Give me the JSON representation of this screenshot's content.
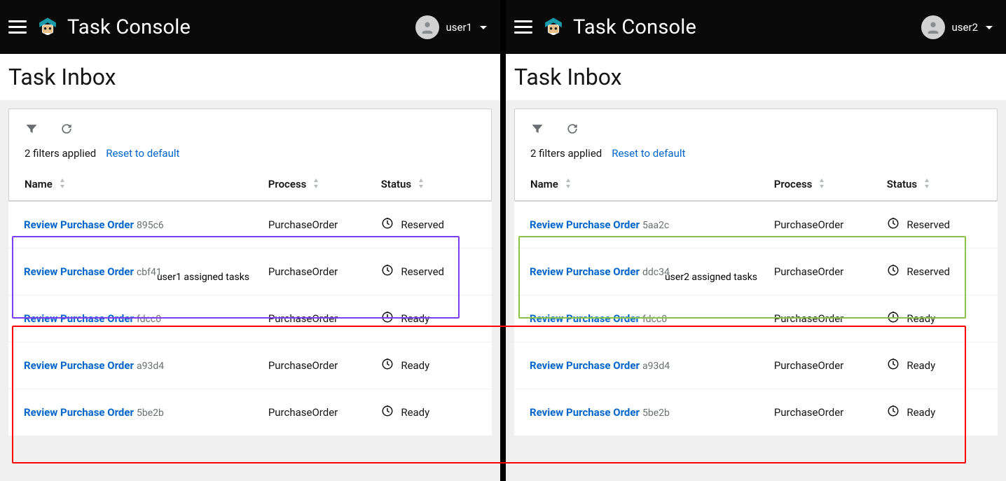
{
  "app_title": "Task Console",
  "page_title": "Task Inbox",
  "filters": {
    "count_text": "2 filters applied",
    "reset_text": "Reset to default"
  },
  "columns": {
    "name": "Name",
    "process": "Process",
    "status": "Status"
  },
  "panels": [
    {
      "user": "user1",
      "annotation_label": "user1 assigned tasks",
      "tasks": [
        {
          "name": "Review Purchase Order",
          "id": "895c6",
          "process": "PurchaseOrder",
          "status": "Reserved"
        },
        {
          "name": "Review Purchase Order",
          "id": "cbf41",
          "process": "PurchaseOrder",
          "status": "Reserved"
        },
        {
          "name": "Review Purchase Order",
          "id": "fdcc0",
          "process": "PurchaseOrder",
          "status": "Ready"
        },
        {
          "name": "Review Purchase Order",
          "id": "a93d4",
          "process": "PurchaseOrder",
          "status": "Ready"
        },
        {
          "name": "Review Purchase Order",
          "id": "5be2b",
          "process": "PurchaseOrder",
          "status": "Ready"
        }
      ]
    },
    {
      "user": "user2",
      "annotation_label": "user2 assigned tasks",
      "tasks": [
        {
          "name": "Review Purchase Order",
          "id": "5aa2c",
          "process": "PurchaseOrder",
          "status": "Reserved"
        },
        {
          "name": "Review Purchase Order",
          "id": "ddc34",
          "process": "PurchaseOrder",
          "status": "Reserved"
        },
        {
          "name": "Review Purchase Order",
          "id": "fdcc0",
          "process": "PurchaseOrder",
          "status": "Ready"
        },
        {
          "name": "Review Purchase Order",
          "id": "a93d4",
          "process": "PurchaseOrder",
          "status": "Ready"
        },
        {
          "name": "Review Purchase Order",
          "id": "5be2b",
          "process": "PurchaseOrder",
          "status": "Ready"
        }
      ]
    }
  ]
}
